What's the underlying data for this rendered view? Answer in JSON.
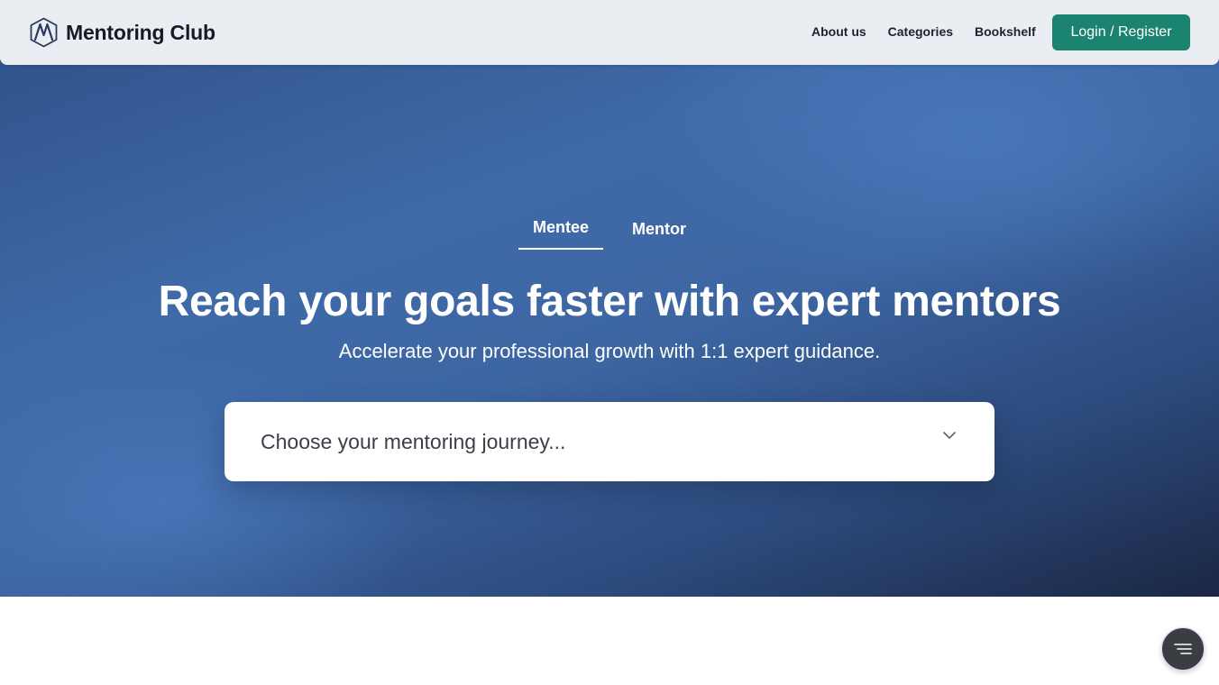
{
  "navbar": {
    "brand_name": "Mentoring Club",
    "links": [
      {
        "label": "About us"
      },
      {
        "label": "Categories"
      },
      {
        "label": "Bookshelf"
      }
    ],
    "login_label": "Login / Register"
  },
  "hero": {
    "tabs": [
      {
        "label": "Mentee",
        "active": true
      },
      {
        "label": "Mentor",
        "active": false
      }
    ],
    "title": "Reach your goals faster with expert mentors",
    "subtitle": "Accelerate your professional growth with 1:1 expert guidance.",
    "journey_select": {
      "placeholder": "Choose your mentoring journey..."
    }
  },
  "colors": {
    "login_button": "#1b8471",
    "hero_blue": "#3f6aa8",
    "hero_dark": "#1b2743",
    "navbar_bg": "#eaeef3"
  },
  "icons": {
    "brand": "mentoring-club-logo-icon",
    "select": "chevron-down-icon",
    "floating": "menu-lines-icon"
  }
}
